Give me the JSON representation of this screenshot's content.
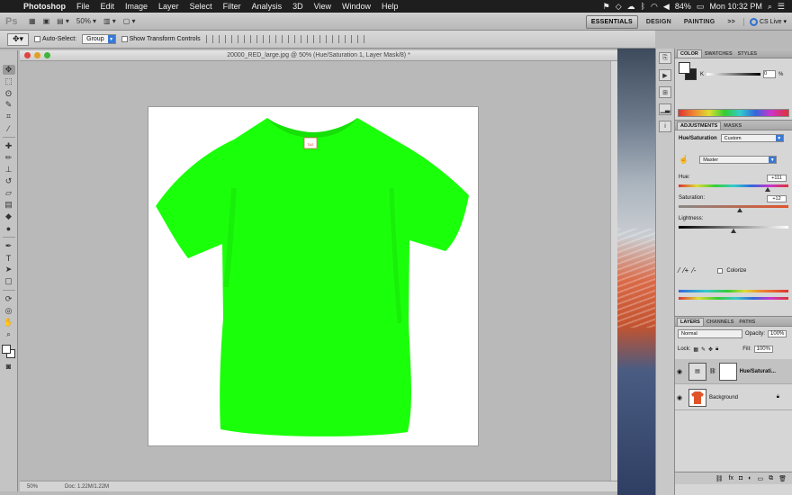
{
  "menubar": {
    "app_name": "Photoshop",
    "menus": [
      "File",
      "Edit",
      "Image",
      "Layer",
      "Select",
      "Filter",
      "Analysis",
      "3D",
      "View",
      "Window",
      "Help"
    ],
    "battery": "84%",
    "clock": "Mon 10:32 PM"
  },
  "appbar": {
    "zoom": "50%",
    "workspaces": [
      "ESSENTIALS",
      "DESIGN",
      "PAINTING"
    ],
    "more": ">>",
    "cs_live": "CS Live"
  },
  "options": {
    "auto_select_label": "Auto-Select:",
    "auto_select_value": "Group",
    "show_transform_label": "Show Transform Controls"
  },
  "document": {
    "title": "20000_RED_large.jpg @ 50% (Hue/Saturation 1, Layer Mask/8) *",
    "zoom_status": "50%",
    "doc_status": "Doc: 1.22M/1.22M",
    "shirt_color": "#1aff0a",
    "collar_tag": "TAG"
  },
  "color_panel": {
    "tabs": [
      "COLOR",
      "SWATCHES",
      "STYLES"
    ],
    "k_label": "K",
    "k_value": "0",
    "percent": "%"
  },
  "adjustments": {
    "tabs": [
      "ADJUSTMENTS",
      "MASKS"
    ],
    "type_label": "Hue/Saturation",
    "preset": "Custom",
    "channel": "Master",
    "hue_label": "Hue:",
    "hue_value": "+111",
    "hue_level": 0.81,
    "saturation_label": "Saturation:",
    "saturation_value": "+12",
    "saturation_level": 0.56,
    "lightness_label": "Lightness:",
    "lightness_value": "0",
    "lightness_level": 0.5,
    "colorize_label": "Colorize"
  },
  "layers": {
    "tabs": [
      "LAYERS",
      "CHANNELS",
      "PATHS"
    ],
    "blend_mode": "Normal",
    "opacity_label": "Opacity:",
    "opacity_value": "100%",
    "lock_label": "Lock:",
    "fill_label": "Fill:",
    "fill_value": "100%",
    "items": [
      {
        "name": "Hue/Saturati..."
      },
      {
        "name": "Background"
      }
    ]
  }
}
